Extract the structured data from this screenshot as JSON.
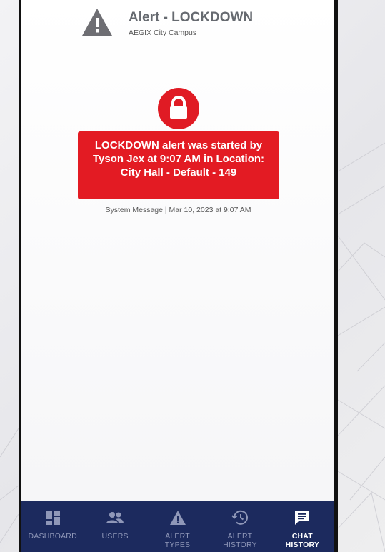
{
  "header": {
    "title": "Alert - LOCKDOWN",
    "subtitle": "AEGIX City Campus",
    "icon": "warning-triangle-icon"
  },
  "alert_icon": "lock-icon",
  "message": {
    "text": "LOCKDOWN alert was started by Tyson Jex at 9:07 AM in Location: City Hall  - Default - 149",
    "meta": "System Message | Mar 10, 2023 at 9:07 AM"
  },
  "tabs": [
    {
      "label": "DASHBOARD",
      "icon": "dashboard-icon"
    },
    {
      "label": "USERS",
      "icon": "users-icon"
    },
    {
      "label": "ALERT\nTYPES",
      "icon": "alert-types-icon"
    },
    {
      "label": "ALERT\nHISTORY",
      "icon": "history-icon"
    },
    {
      "label": "CHAT\nHISTORY",
      "icon": "chat-icon"
    }
  ],
  "active_tab": "CHAT HISTORY",
  "colors": {
    "alert_red": "#e31b23",
    "tabbar_navy": "#1c2a5e",
    "tab_inactive": "#8f97b8",
    "header_gray": "#666a70"
  }
}
